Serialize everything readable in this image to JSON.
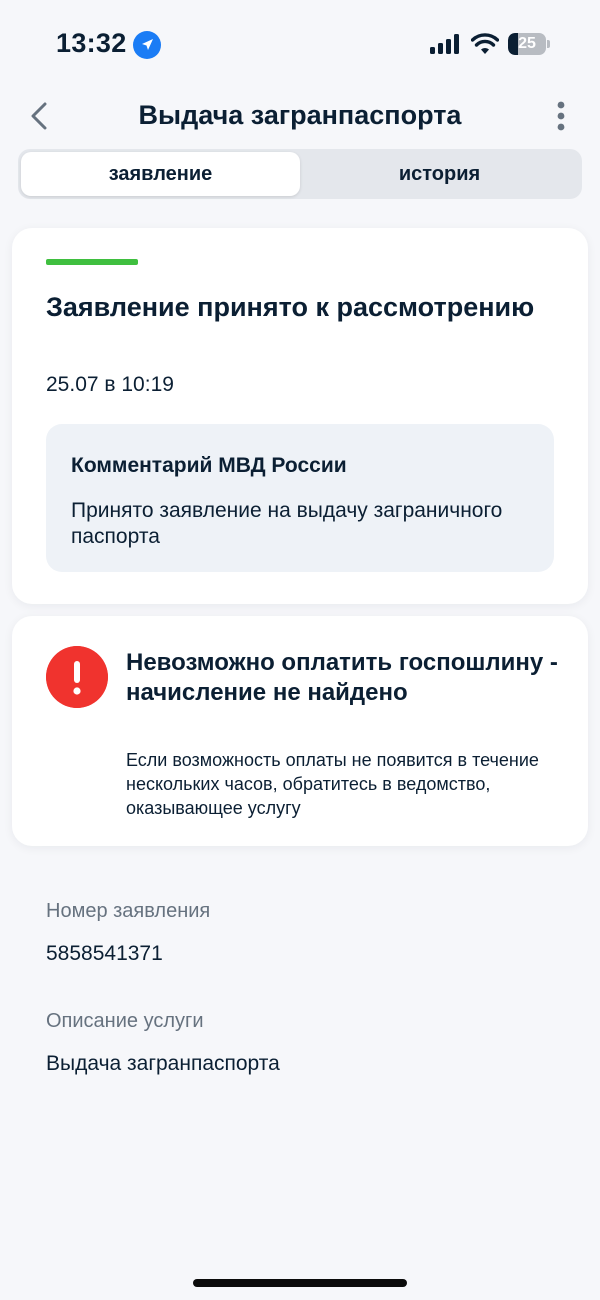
{
  "status_bar": {
    "time": "13:32",
    "battery_level": "25",
    "battery_fraction": 0.25
  },
  "header": {
    "title": "Выдача загранпаспорта",
    "back_icon": "chevron-left-icon",
    "more_icon": "more-vertical-icon"
  },
  "tabs": [
    {
      "label": "заявление",
      "active": true
    },
    {
      "label": "история",
      "active": false
    }
  ],
  "status_card": {
    "accent_color": "#3fbf3f",
    "title": "Заявление принято к рассмотрению",
    "date": "25.07 в 10:19",
    "comment": {
      "title": "Комментарий МВД России",
      "text": "Принято заявление на выдачу заграничного паспорта"
    }
  },
  "error_card": {
    "icon": "exclamation-icon",
    "icon_color": "#f0332e",
    "title": "Невозможно оплатить госпошлину - начисление не найдено",
    "text": "Если возможность оплаты не появится в течение нескольких часов, обратитесь в ведомство, оказывающее услугу"
  },
  "details": {
    "application_number_label": "Номер заявления",
    "application_number": "5858541371",
    "service_description_label": "Описание услуги",
    "service_description": "Выдача загранпаспорта"
  }
}
